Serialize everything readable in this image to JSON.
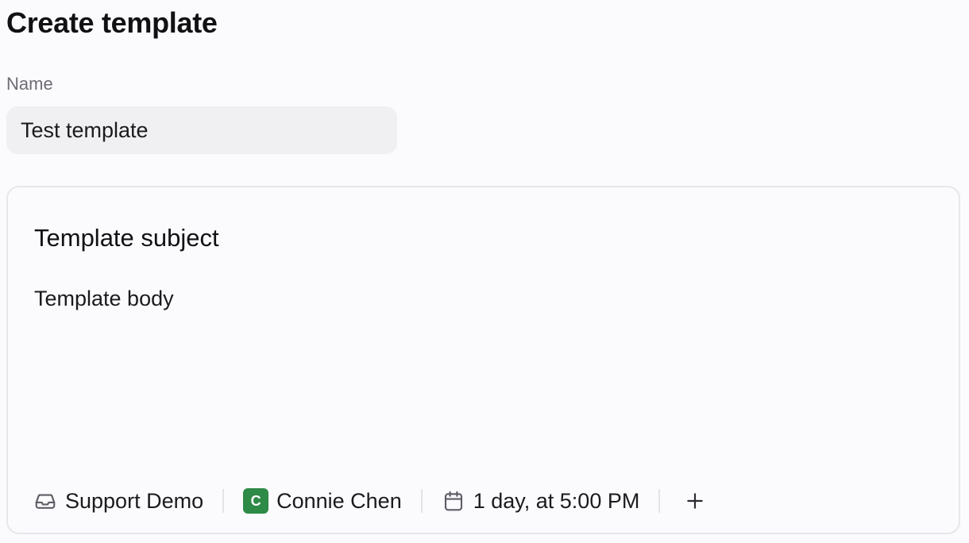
{
  "page": {
    "title": "Create template"
  },
  "form": {
    "name_label": "Name",
    "name_value": "Test template"
  },
  "editor": {
    "subject": "Template subject",
    "body": "Template body"
  },
  "meta_bar": {
    "inbox": {
      "label": "Support Demo",
      "icon": "inbox-icon"
    },
    "assignee": {
      "label": "Connie Chen",
      "avatar_initial": "C",
      "avatar_color": "#2e8a47"
    },
    "due": {
      "label": "1 day, at 5:00 PM",
      "icon": "calendar-icon"
    },
    "add": {
      "icon": "plus-icon"
    }
  }
}
